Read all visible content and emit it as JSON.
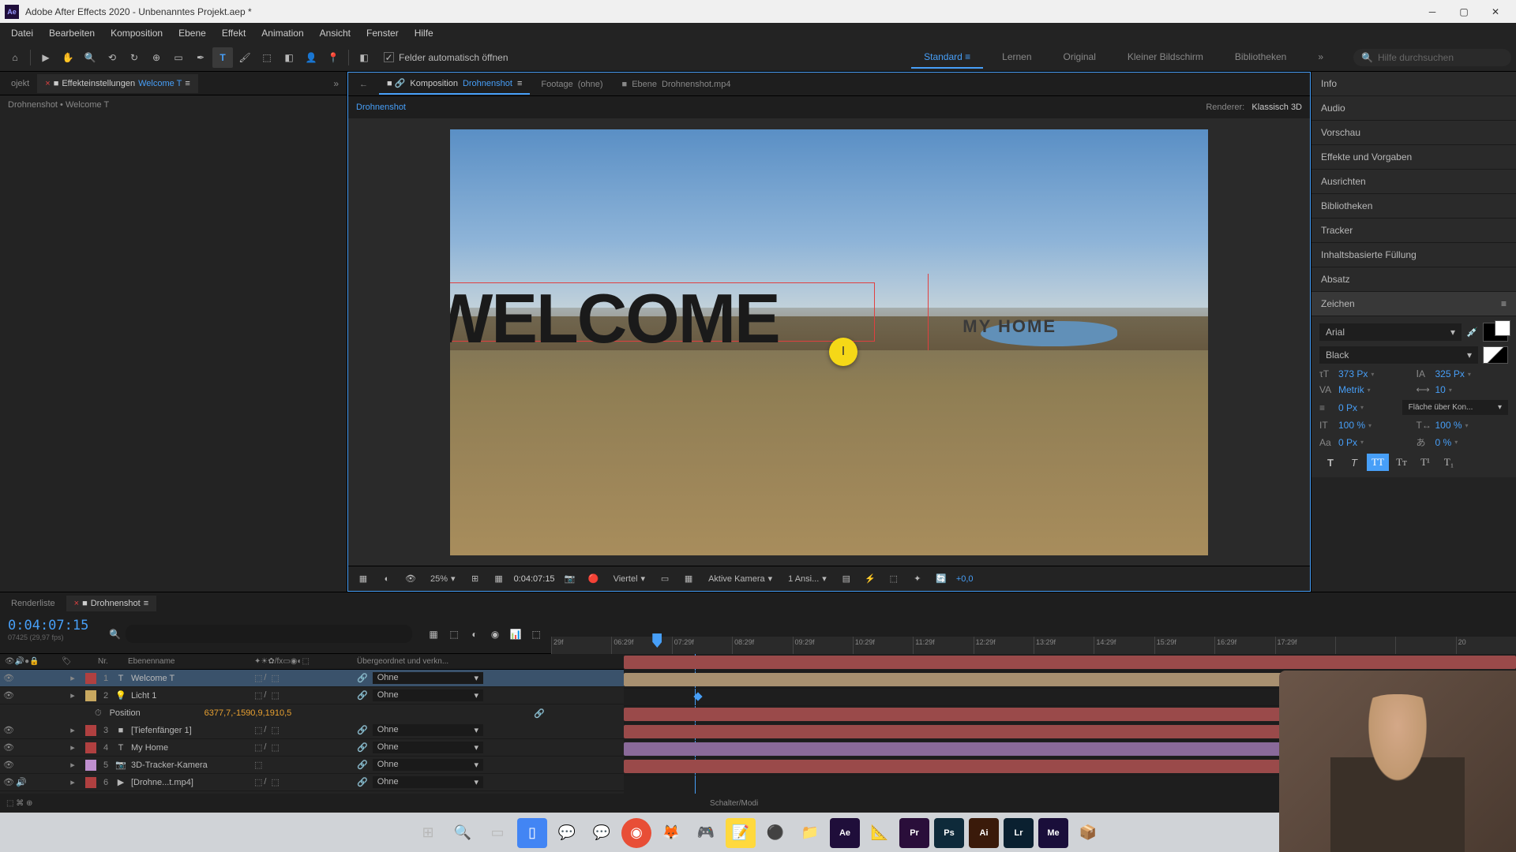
{
  "titlebar": {
    "app_name": "Adobe After Effects 2020",
    "project": "Unbenanntes Projekt.aep *"
  },
  "menu": {
    "items": [
      "Datei",
      "Bearbeiten",
      "Komposition",
      "Ebene",
      "Effekt",
      "Animation",
      "Ansicht",
      "Fenster",
      "Hilfe"
    ]
  },
  "toolbar": {
    "auto_open_label": "Felder automatisch öffnen",
    "workspaces": [
      "Standard",
      "Lernen",
      "Original",
      "Kleiner Bildschirm",
      "Bibliotheken"
    ],
    "active_workspace": "Standard",
    "search_placeholder": "Hilfe durchsuchen"
  },
  "left_panel": {
    "tab_effects": "Effekteinstellungen",
    "tab_effects_item": "Welcome T",
    "breadcrumb": "Drohnenshot • Welcome T"
  },
  "comp_panel": {
    "tab1_prefix": "Komposition",
    "tab1_name": "Drohnenshot",
    "tab2_prefix": "Footage",
    "tab2_name": "(ohne)",
    "tab3_prefix": "Ebene",
    "tab3_name": "Drohnenshot.mp4",
    "nav_item": "Drohnenshot",
    "renderer_label": "Renderer:",
    "renderer_value": "Klassisch 3D",
    "active_camera_label": "Aktive Kamera",
    "text_welcome": "WELCOME",
    "text_myhome": "MY HOME"
  },
  "viewer_controls": {
    "zoom": "25%",
    "timecode": "0:04:07:15",
    "resolution": "Viertel",
    "camera": "Aktive Kamera",
    "views": "1 Ansi...",
    "exposure": "+0,0"
  },
  "right_panels": {
    "items": [
      "Info",
      "Audio",
      "Vorschau",
      "Effekte und Vorgaben",
      "Ausrichten",
      "Bibliotheken",
      "Tracker",
      "Inhaltsbasierte Füllung",
      "Absatz"
    ],
    "character": {
      "title": "Zeichen",
      "font": "Arial",
      "style": "Black",
      "size": "373 Px",
      "leading": "325 Px",
      "kerning": "Metrik",
      "tracking": "10",
      "stroke": "0 Px",
      "stroke_mode": "Fläche über Kon...",
      "vscale": "100 %",
      "hscale": "100 %",
      "baseline": "0 Px",
      "tsume": "0 %"
    }
  },
  "timeline": {
    "tab_render": "Renderliste",
    "tab_comp": "Drohnenshot",
    "timecode": "0:04:07:15",
    "framerate": "07425 (29,97 fps)",
    "col_nr": "Nr.",
    "col_name": "Ebenenname",
    "col_parent": "Übergeordnet und verkn...",
    "parent_none": "Ohne",
    "switch_label": "Schalter/Modi",
    "ruler_ticks": [
      "29f",
      "06:29f",
      "07:29f",
      "08:29f",
      "09:29f",
      "10:29f",
      "11:29f",
      "12:29f",
      "13:29f",
      "14:29f",
      "15:29f",
      "16:29f",
      "17:29f",
      "",
      "",
      "20"
    ],
    "layers": [
      {
        "num": "1",
        "name": "Welcome T",
        "color": "#b04040",
        "type": "T",
        "selected": true
      },
      {
        "num": "2",
        "name": "Licht 1",
        "color": "#c8a860",
        "type": "light"
      },
      {
        "num": "3",
        "name": "[Tiefenfänger 1]",
        "color": "#b04040",
        "type": "solid"
      },
      {
        "num": "4",
        "name": "My Home",
        "color": "#b04040",
        "type": "T"
      },
      {
        "num": "5",
        "name": "3D-Tracker-Kamera",
        "color": "#c090d0",
        "type": "cam"
      },
      {
        "num": "6",
        "name": "[Drohne...t.mp4]",
        "color": "#b04040",
        "type": "video"
      }
    ],
    "prop_position": "Position",
    "prop_position_val": "6377,7,-1590,9,1910,5"
  }
}
